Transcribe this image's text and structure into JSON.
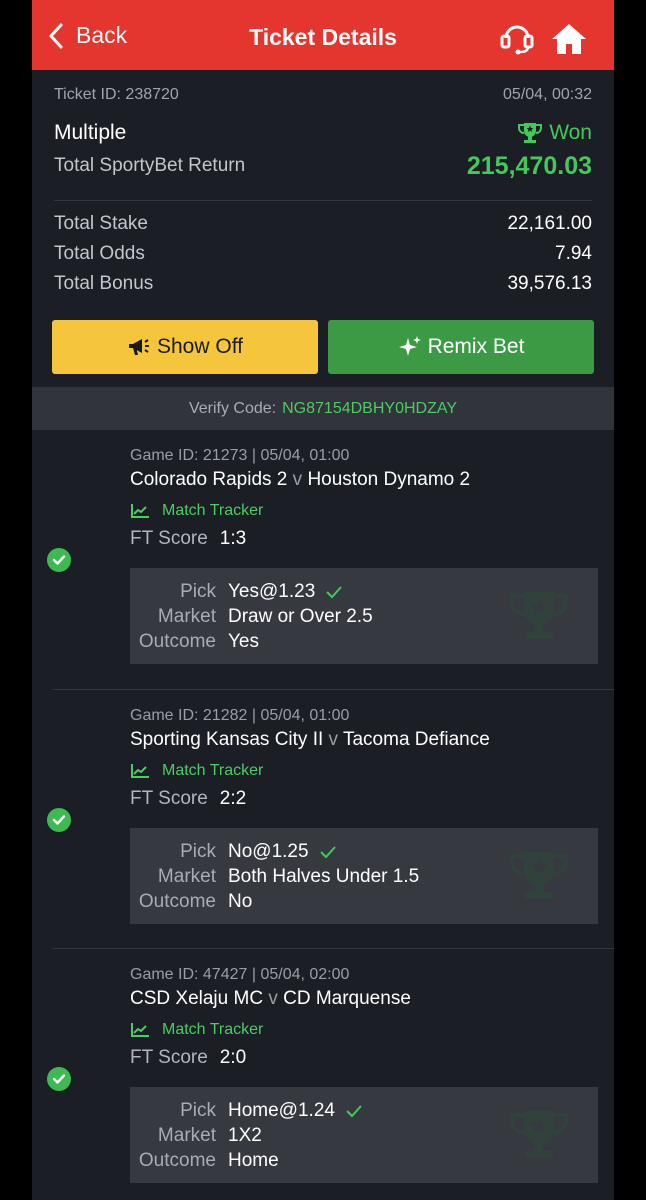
{
  "header": {
    "back_label": "Back",
    "title": "Ticket Details"
  },
  "ticket": {
    "id_label": "Ticket ID: 238720",
    "datetime": "05/04, 00:32",
    "type": "Multiple",
    "status": "Won",
    "return_label": "Total SportyBet Return",
    "return_value": "215,470.03",
    "stake_label": "Total Stake",
    "stake_value": "22,161.00",
    "odds_label": "Total Odds",
    "odds_value": "7.94",
    "bonus_label": "Total Bonus",
    "bonus_value": "39,576.13"
  },
  "buttons": {
    "show_off": "Show Off",
    "remix": "Remix Bet"
  },
  "verify": {
    "label": "Verify Code:",
    "code": "NG87154DBHY0HDZAY"
  },
  "events": [
    {
      "game": "Game ID: 21273 | 05/04, 01:00",
      "home": "Colorado Rapids 2",
      "vs": "v",
      "away": "Houston Dynamo 2",
      "tracker": "Match Tracker",
      "ft_label": "FT Score",
      "ft_value": "1:3",
      "pick_label": "Pick",
      "pick_value": "Yes@1.23",
      "market_label": "Market",
      "market_value": "Draw or Over 2.5",
      "outcome_label": "Outcome",
      "outcome_value": "Yes"
    },
    {
      "game": "Game ID: 21282 | 05/04, 01:00",
      "home": "Sporting Kansas City II",
      "vs": "v",
      "away": "Tacoma Defiance",
      "tracker": "Match Tracker",
      "ft_label": "FT Score",
      "ft_value": "2:2",
      "pick_label": "Pick",
      "pick_value": "No@1.25",
      "market_label": "Market",
      "market_value": "Both Halves Under 1.5",
      "outcome_label": "Outcome",
      "outcome_value": "No"
    },
    {
      "game": "Game ID: 47427 | 05/04, 02:00",
      "home": "CSD Xelaju MC",
      "vs": "v",
      "away": "CD Marquense",
      "tracker": "Match Tracker",
      "ft_label": "FT Score",
      "ft_value": "2:0",
      "pick_label": "Pick",
      "pick_value": "Home@1.24",
      "market_label": "Market",
      "market_value": "1X2",
      "outcome_label": "Outcome",
      "outcome_value": "Home"
    }
  ],
  "colors": {
    "header": "#e4352f",
    "accent_green": "#42c95b",
    "show_off": "#f5c53b",
    "remix": "#3c9a45",
    "background": "#1b1e25"
  },
  "icons": [
    "chevron-left-icon",
    "headset-icon",
    "home-icon",
    "trophy-icon",
    "megaphone-icon",
    "sparkle-icon",
    "check-circle-icon",
    "chart-icon",
    "checkmark-icon"
  ]
}
